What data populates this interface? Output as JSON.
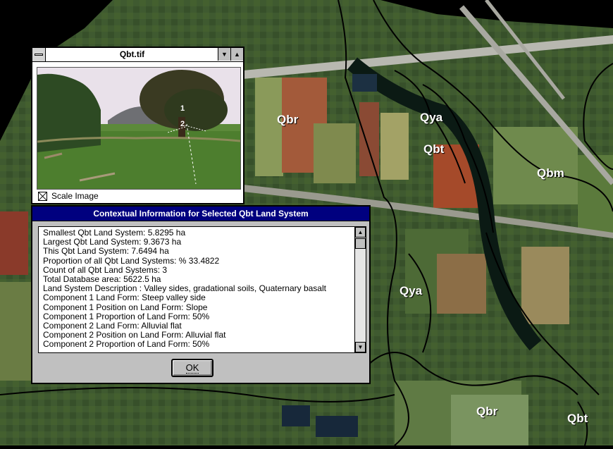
{
  "map": {
    "labels": [
      "Qbr",
      "Qya",
      "Qbt",
      "Qbm",
      "Qya",
      "Qbr",
      "Qbt"
    ]
  },
  "image_window": {
    "title": "Qbt.tif",
    "photo_marker_1": "1",
    "photo_marker_2": "2",
    "scale_checkbox_label": "Scale Image"
  },
  "dialog": {
    "title": "Contextual Information for Selected Qbt Land System",
    "lines": [
      "Smallest Qbt Land System:  5.8295 ha",
      "Largest Qbt Land System:  9.3673 ha",
      "This Qbt Land System:  7.6494 ha",
      "Proportion of all Qbt Land Systems: % 33.4822",
      "Count of all Qbt Land Systems: 3",
      "Total Database area: 5622.5 ha",
      "Land System Description : Valley sides, gradational soils, Quaternary basalt",
      "Component 1 Land Form: Steep valley side",
      "Component 1 Position on Land Form: Slope",
      "Component 1 Proportion of Land Form:  50%",
      "Component 2 Land Form: Alluvial flat",
      "Component 2 Position on Land Form: Alluvial flat",
      "Component 2 Proportion of Land Form:  50%"
    ],
    "ok_label": "OK"
  }
}
